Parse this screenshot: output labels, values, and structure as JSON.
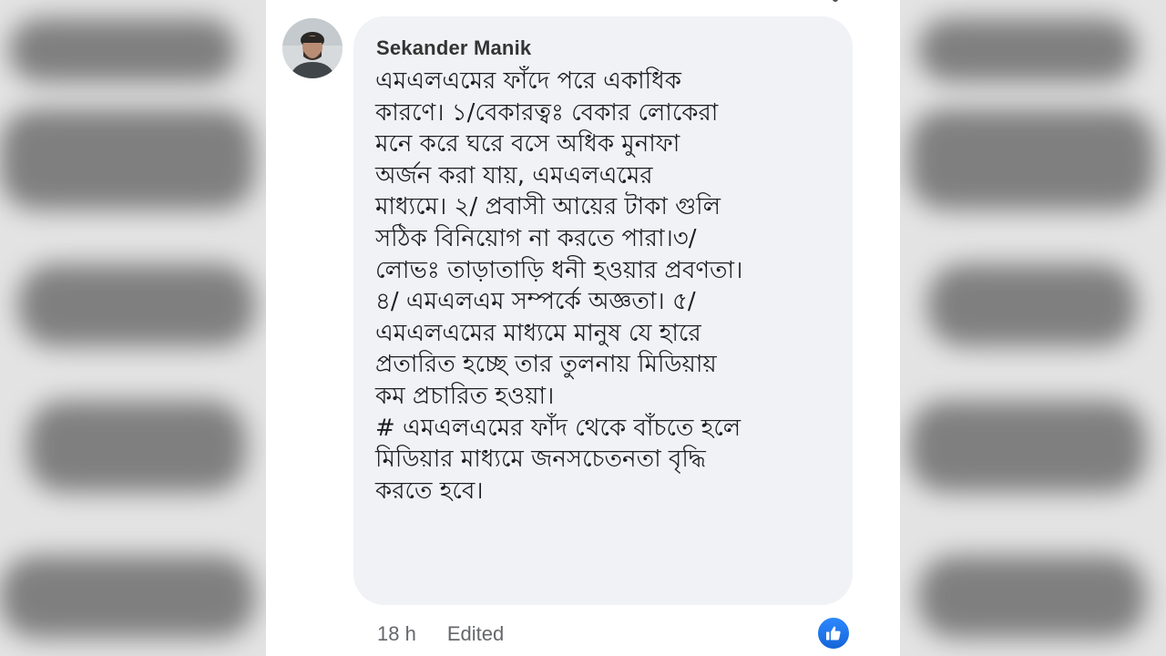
{
  "comment": {
    "author": "Sekander Manik",
    "lines": [
      "এমএলএমের ফাঁদে পরে একাধিক",
      "কারণে। ১/বেকারত্বঃ বেকার লোকেরা",
      "মনে করে ঘরে বসে অধিক মুনাফা",
      "অর্জন করা যায়, এমএলএমের",
      "মাধ্যমে। ২/ প্রবাসী আয়ের টাকা গুলি",
      "সঠিক বিনিয়োগ না করতে পারা।৩/",
      "লোভঃ তাড়াতাড়ি ধনী হওয়ার প্রবণতা।",
      "৪/ এমএলএম সম্পর্কে অজ্ঞতা। ৫/",
      "এমএলএমের মাধ্যমে মানুষ যে হারে",
      "প্রতারিত হচ্ছে তার তুলনায় মিডিয়ায়",
      "কম প্রচারিত হওয়া।",
      "# এমএলএমের ফাঁদ থেকে বাঁচতে হলে",
      "মিডিয়ার মাধ্যমে জনসচেতনতা বৃদ্ধি",
      "করতে হবে।"
    ],
    "time": "18 h",
    "edited": "Edited"
  },
  "icons": {
    "avatar": "profile-photo",
    "reaction": "like-icon"
  },
  "colors": {
    "bubble": "#f0f2f5",
    "meta_text": "#65676b",
    "like_blue": "#1877f2"
  }
}
